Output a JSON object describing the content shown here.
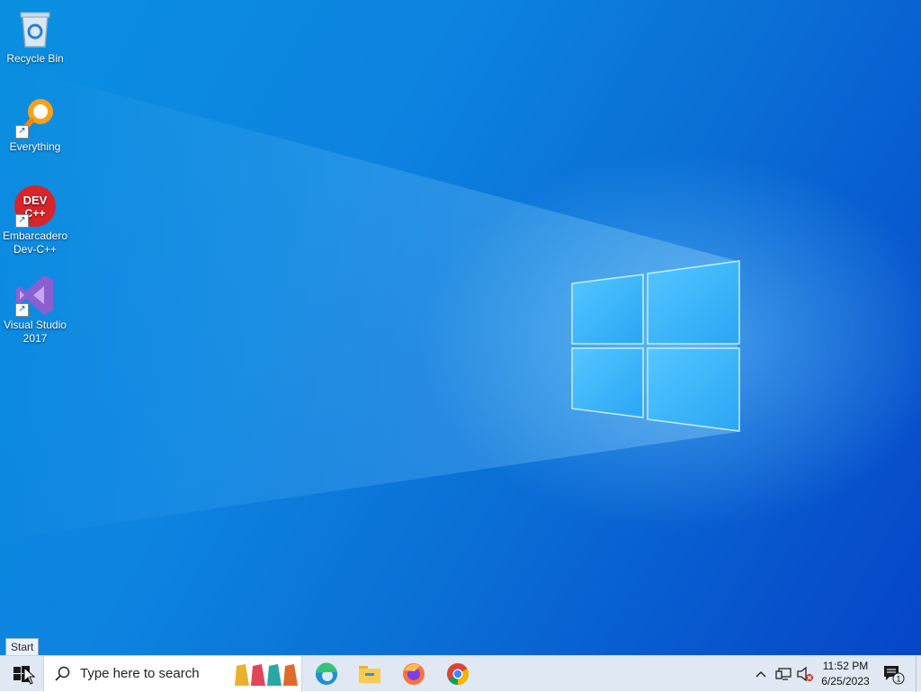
{
  "desktop": {
    "icons": [
      {
        "label": "Recycle Bin",
        "icon": "recycle-bin-icon"
      },
      {
        "label": "Everything",
        "icon": "everything-search-icon"
      },
      {
        "label_line1": "Embarcadero",
        "label_line2": "Dev-C++",
        "icon": "devcpp-icon",
        "logo_text_top": "DEV",
        "logo_text_bottom": "C++"
      },
      {
        "label_line1": "Visual Studio",
        "label_line2": "2017",
        "icon": "visual-studio-icon"
      }
    ]
  },
  "tooltip": {
    "text": "Start"
  },
  "taskbar": {
    "search_placeholder": "Type here to search",
    "pinned": [
      "edge-icon",
      "file-explorer-icon",
      "firefox-icon",
      "chrome-icon"
    ],
    "tray": {
      "time": "11:52 PM",
      "date": "6/25/2023",
      "notification_count": "1"
    }
  },
  "colors": {
    "wallpaper_light": "#0a8fe0",
    "wallpaper_dark": "#0645c8",
    "taskbar": "#dfe8f3"
  }
}
